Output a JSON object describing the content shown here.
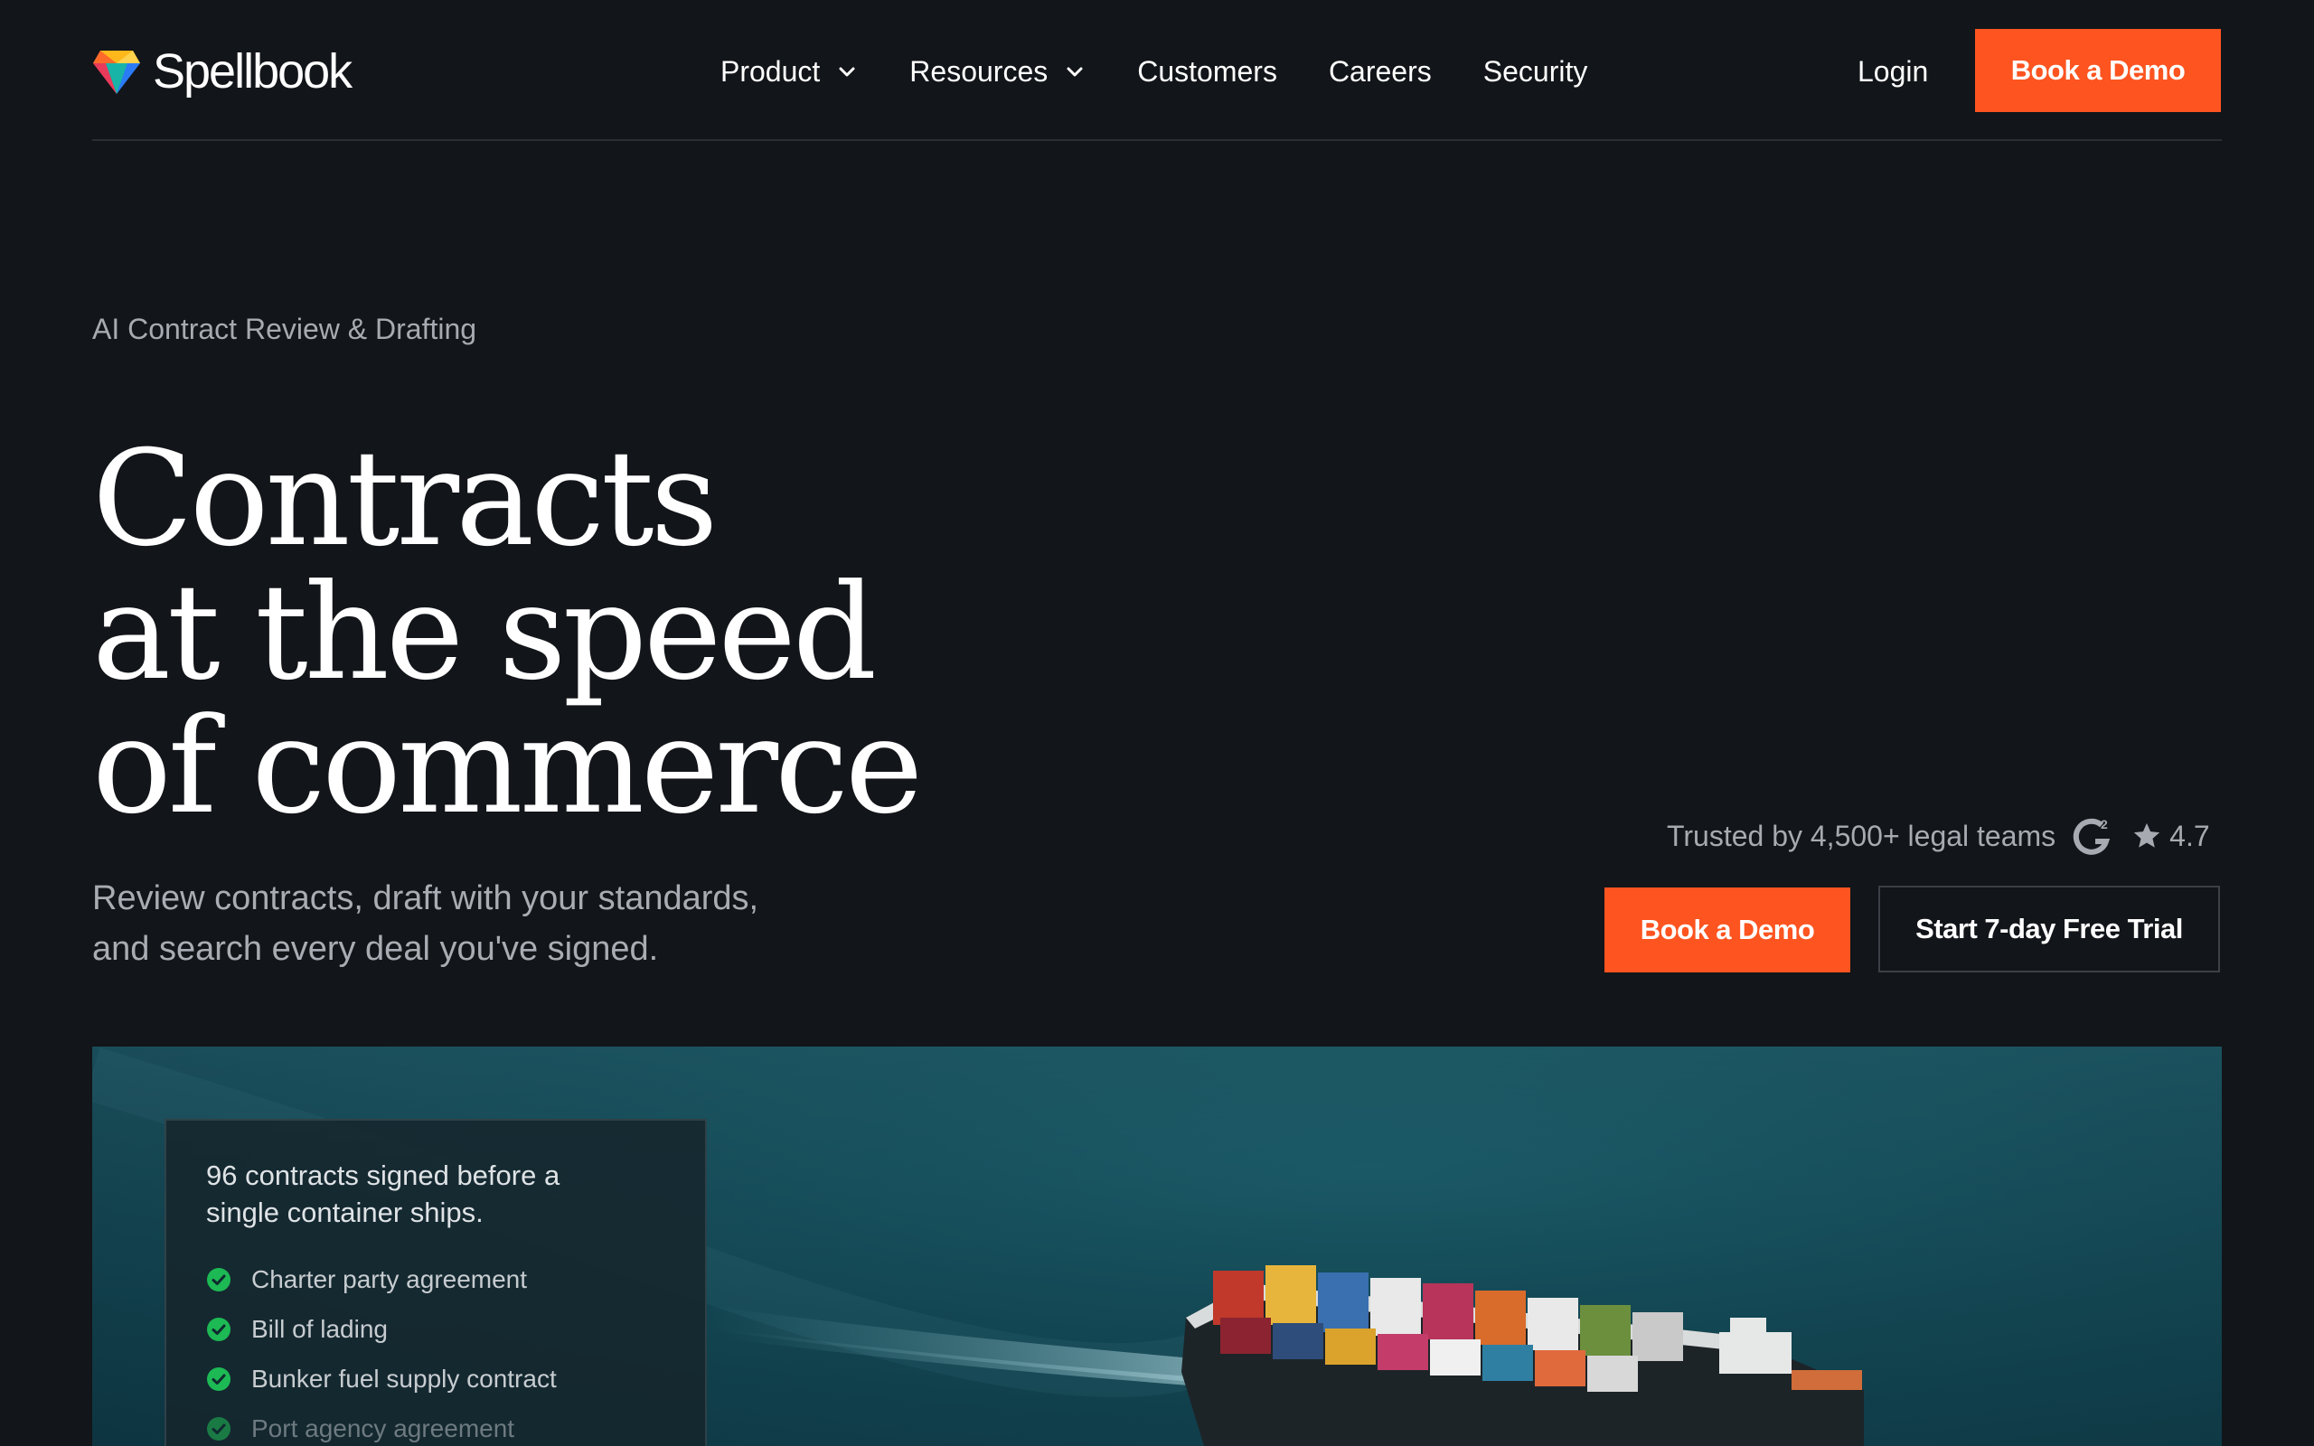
{
  "brand": {
    "name": "Spellbook"
  },
  "nav": {
    "items": [
      {
        "label": "Product",
        "has_dropdown": true
      },
      {
        "label": "Resources",
        "has_dropdown": true
      },
      {
        "label": "Customers",
        "has_dropdown": false
      },
      {
        "label": "Careers",
        "has_dropdown": false
      },
      {
        "label": "Security",
        "has_dropdown": false
      }
    ],
    "login_label": "Login",
    "cta_label": "Book a Demo"
  },
  "hero": {
    "eyebrow": "AI Contract Review & Drafting",
    "headline": [
      "Contracts",
      "at the speed",
      "of commerce"
    ],
    "subhead_lines": [
      "Review contracts, draft with your standards,",
      "and search every deal you've signed."
    ],
    "trusted_text": "Trusted by 4,500+ legal teams",
    "rating": "4.7",
    "primary_cta": "Book a Demo",
    "secondary_cta": "Start 7-day Free Trial"
  },
  "showcase": {
    "card_title": "96 contracts signed before a single container ships.",
    "checklist": [
      {
        "label": "Charter party agreement",
        "faded": false
      },
      {
        "label": "Bill of lading",
        "faded": false
      },
      {
        "label": "Bunker fuel supply contract",
        "faded": false
      },
      {
        "label": "Port agency agreement",
        "faded": true
      }
    ]
  },
  "colors": {
    "background": "#121519",
    "accent": "#fd5420",
    "check": "#1db954",
    "ocean": "#124652"
  }
}
